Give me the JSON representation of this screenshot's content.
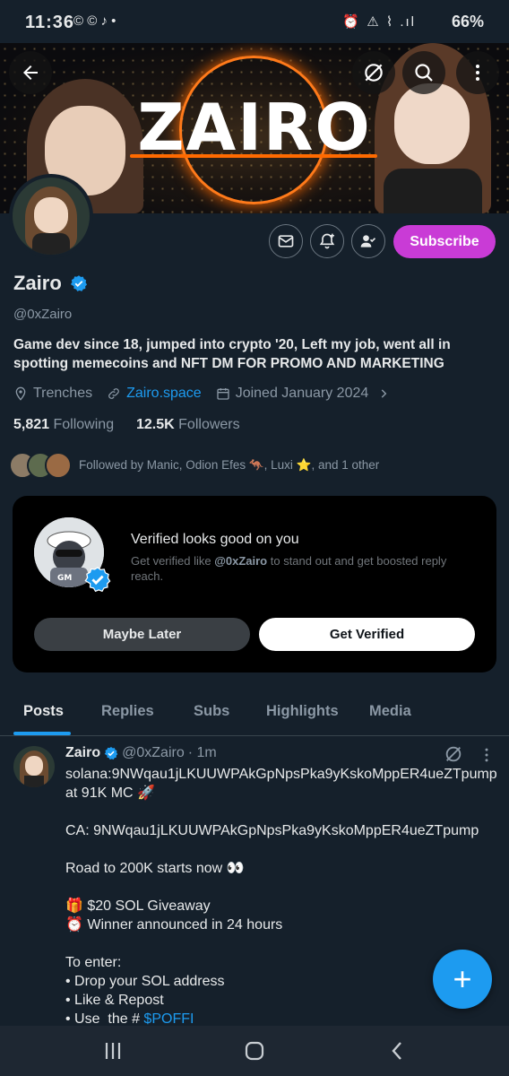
{
  "status_bar": {
    "time": "11:36",
    "battery": "66%",
    "left_icons": "© © ♪ •",
    "right_icons": "⏰ ⚠ ⌇ .ıl"
  },
  "banner": {
    "logo_text": "ZAIRO"
  },
  "profile": {
    "name": "Zairo",
    "handle": "@0xZairo",
    "bio": "Game dev since 18, jumped into crypto '20, Left my job, went all in spotting memecoins and NFT DM   FOR PROMO AND MARKETING",
    "location": "Trenches",
    "website": "Zairo.space",
    "joined": "Joined January 2024",
    "following_count": "5,821",
    "following_label": "Following",
    "followers_count": "12.5K",
    "followers_label": "Followers",
    "followed_by": "Followed by Manic, Odion Efes 🦘, Luxi ⭐, and 1 other",
    "subscribe_label": "Subscribe"
  },
  "verify_card": {
    "title": "Verified looks good on you",
    "sub_before": "Get verified like ",
    "sub_handle": "@0xZairo",
    "sub_after": " to stand out and get boosted reply reach.",
    "maybe_later": "Maybe Later",
    "get_verified": "Get Verified",
    "avatar_text": "GM"
  },
  "tabs": [
    "Posts",
    "Replies",
    "Subs",
    "Highlights",
    "Media"
  ],
  "post": {
    "name": "Zairo",
    "handle": "@0xZairo",
    "time": "· 1m",
    "body": "solana:9NWqau1jLKUUWPAkGpNpsPka9yKskoMppER4ueZTpump at 91K MC 🚀\n\nCA: 9NWqau1jLKUUWPAkGpNpsPka9yKskoMppER4ueZTpump\n\nRoad to 200K starts now 👀\n\n🎁 $20 SOL Giveaway\n⏰ Winner announced in 24 hours\n\nTo enter:\n• Drop your SOL address\n• Like & Repost\n• Use  the # ",
    "hashtag": "$POFFI"
  },
  "fab_symbol": "+",
  "colors": {
    "accent": "#1d9bf0",
    "subscribe": "#c93bd6",
    "background": "#15202b",
    "banner_ring": "#ff7a1a"
  }
}
